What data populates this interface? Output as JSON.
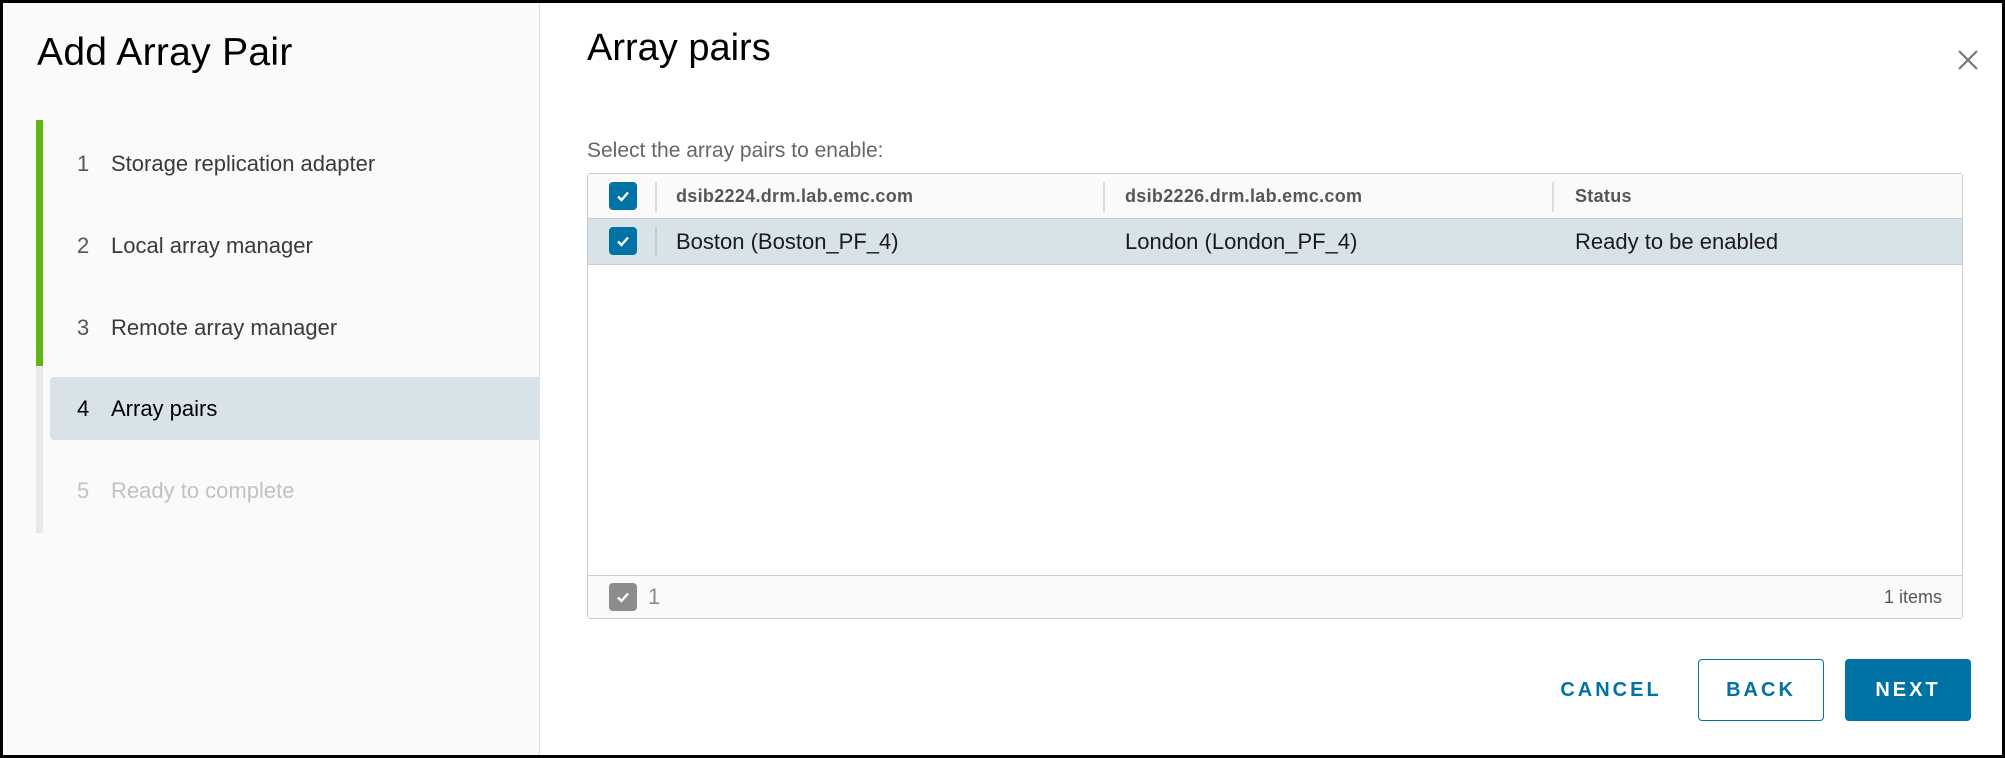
{
  "wizard": {
    "title": "Add Array Pair",
    "steps": [
      {
        "number": "1",
        "label": "Storage replication adapter",
        "state": "completed"
      },
      {
        "number": "2",
        "label": "Local array manager",
        "state": "completed"
      },
      {
        "number": "3",
        "label": "Remote array manager",
        "state": "completed"
      },
      {
        "number": "4",
        "label": "Array pairs",
        "state": "active"
      },
      {
        "number": "5",
        "label": "Ready to complete",
        "state": "disabled"
      }
    ],
    "progress_color": "#60b515"
  },
  "page": {
    "title": "Array pairs",
    "instruction": "Select the array pairs to enable:",
    "close_icon": "close-icon"
  },
  "grid": {
    "select_all_checked": true,
    "columns": [
      "dsib2224.drm.lab.emc.com",
      "dsib2226.drm.lab.emc.com",
      "Status"
    ],
    "rows": [
      {
        "checked": true,
        "cells": [
          "Boston (Boston_PF_4)",
          "London (London_PF_4)",
          "Ready to be enabled"
        ]
      }
    ],
    "footer": {
      "selected_count": "1",
      "items_label": "1 items"
    }
  },
  "buttons": {
    "cancel": "CANCEL",
    "back": "BACK",
    "next": "NEXT"
  },
  "colors": {
    "accent": "#0072a3",
    "selected_row": "#d8e3e9"
  }
}
